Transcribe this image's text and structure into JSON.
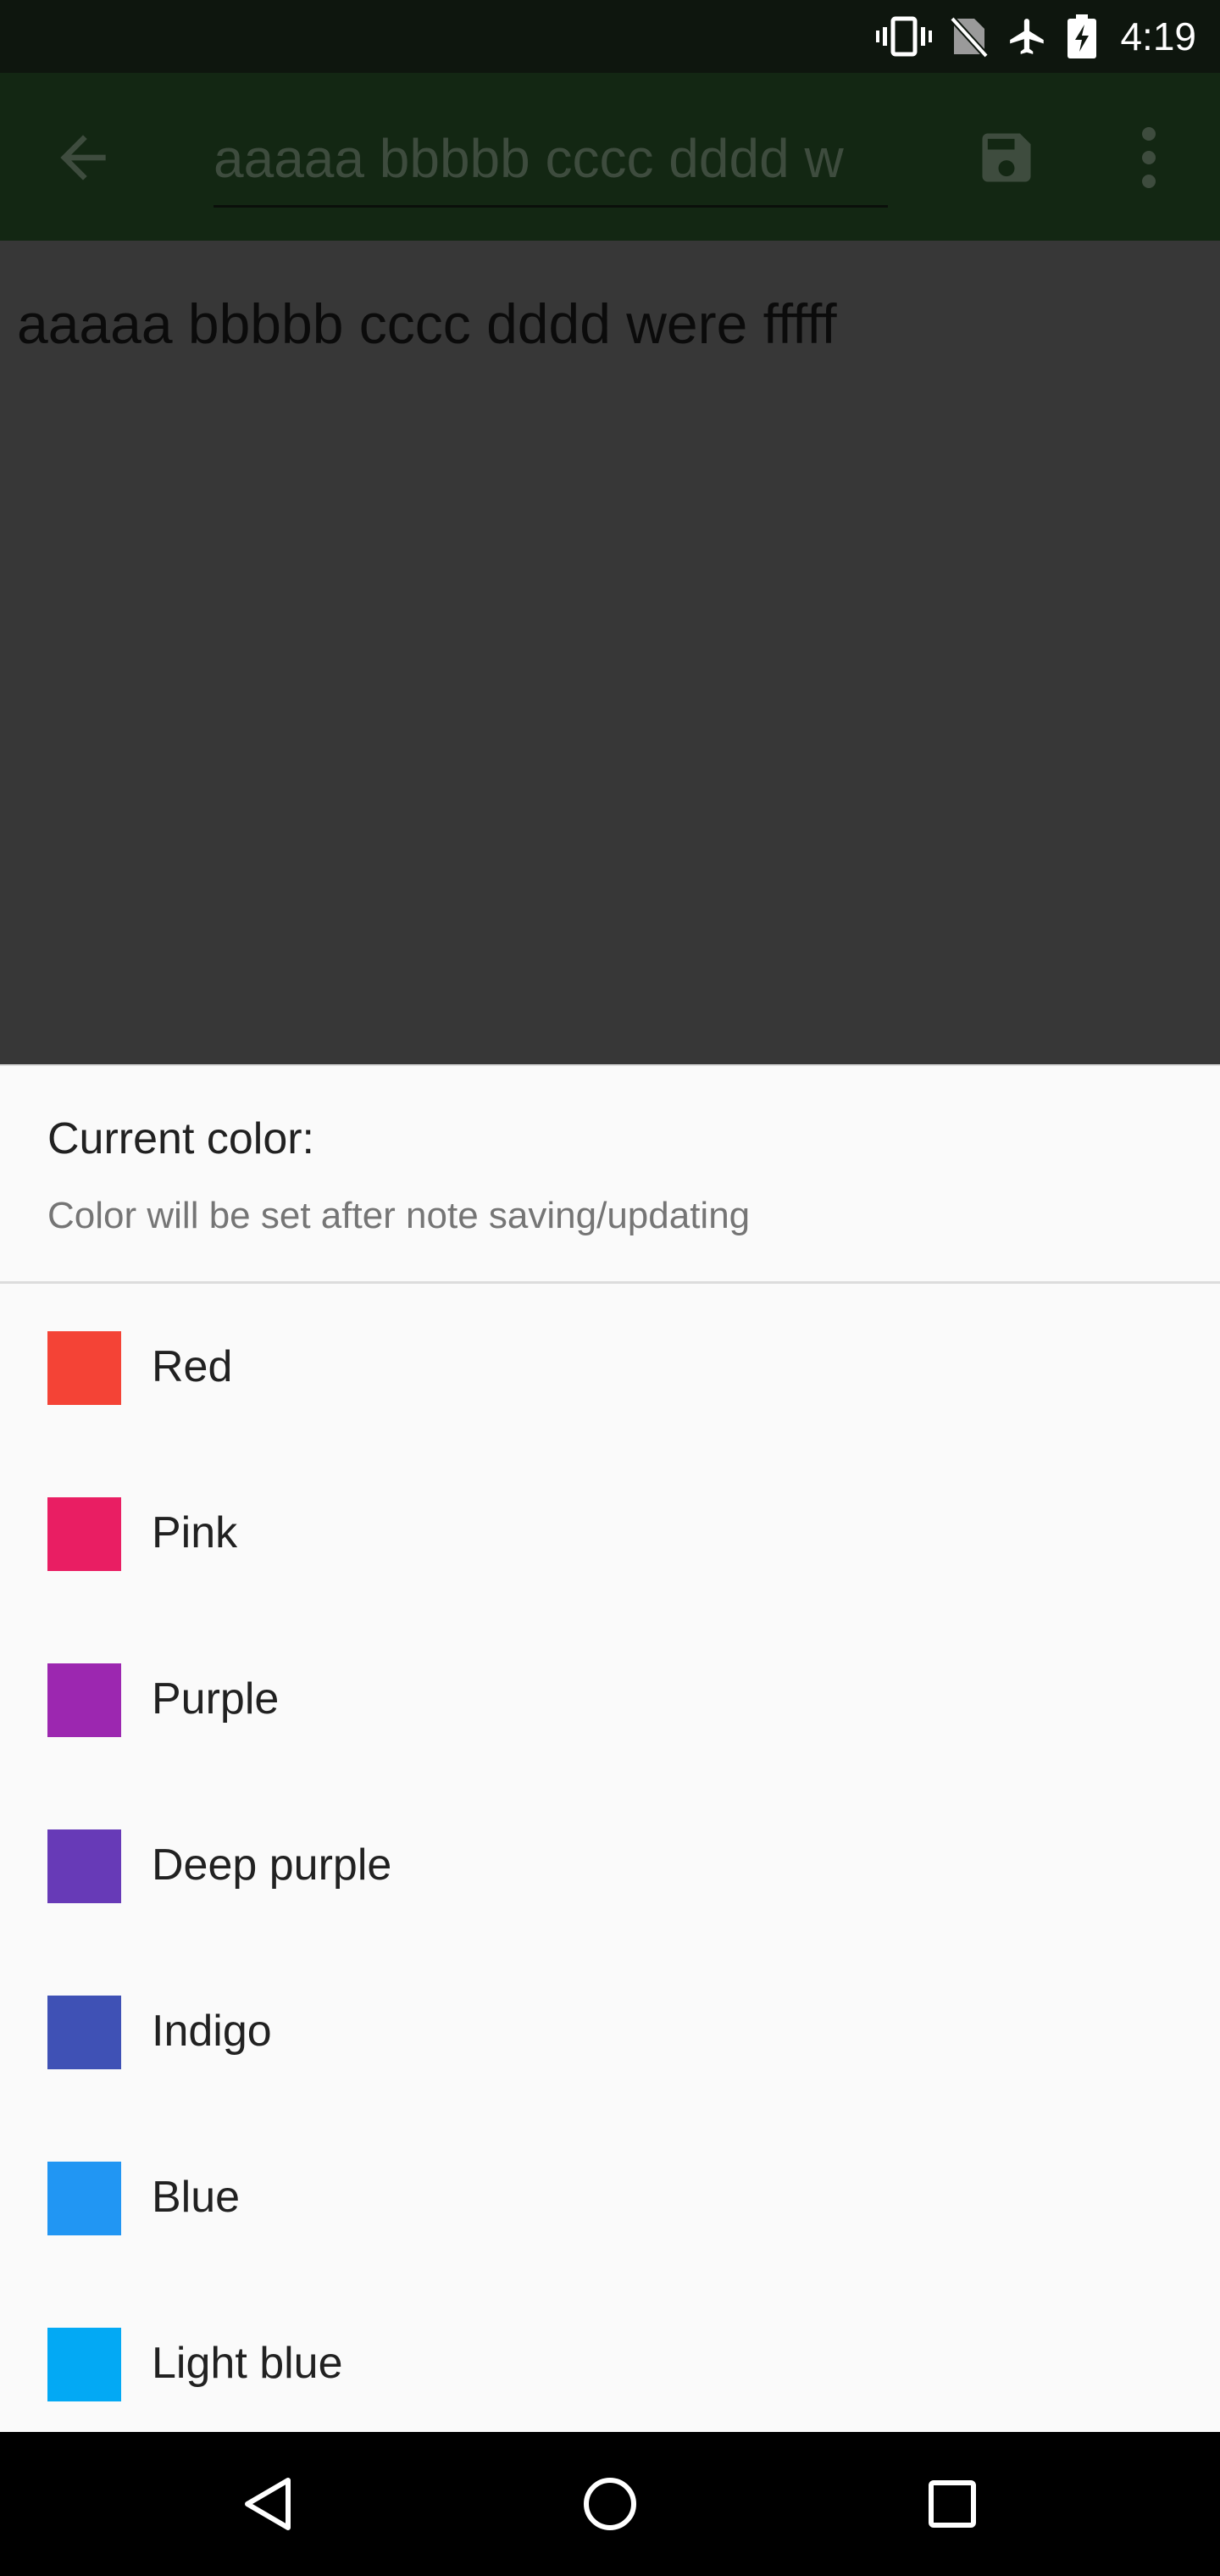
{
  "status_bar": {
    "time": "4:19",
    "icons": [
      "vibrate-icon",
      "no-sim-icon",
      "airplane-icon",
      "battery-charging-icon"
    ]
  },
  "toolbar": {
    "back_icon": "arrow-back-icon",
    "title_value": "aaaaa bbbbb cccc dddd w",
    "save_icon": "save-icon",
    "more_icon": "more-vert-icon"
  },
  "note": {
    "text": "aaaaa bbbbb cccc dddd were fffff"
  },
  "sheet": {
    "title": "Current color:",
    "subtitle": "Color will be set after note saving/updating",
    "colors": [
      {
        "label": "Red",
        "color": "#f44336"
      },
      {
        "label": "Pink",
        "color": "#e91e63"
      },
      {
        "label": "Purple",
        "color": "#9c27b0"
      },
      {
        "label": "Deep purple",
        "color": "#673ab7"
      },
      {
        "label": "Indigo",
        "color": "#3f51b5"
      },
      {
        "label": "Blue",
        "color": "#2196f3"
      },
      {
        "label": "Light blue",
        "color": "#03a9f4"
      }
    ]
  },
  "nav_bar": {
    "icons": [
      "back-triangle-icon",
      "home-circle-icon",
      "recents-square-icon"
    ]
  }
}
